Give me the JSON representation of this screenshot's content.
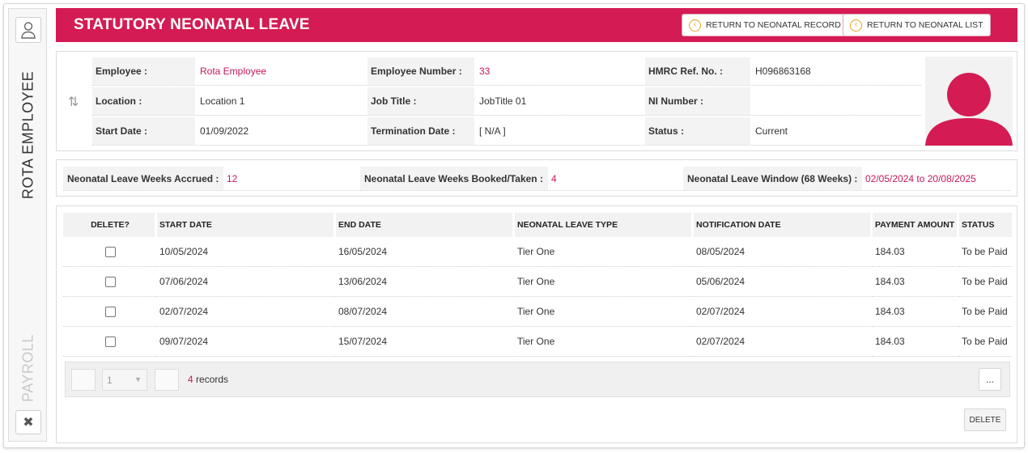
{
  "rail": {
    "title": "ROTA EMPLOYEE",
    "section": "PAYROLL",
    "user_icon": "user-icon",
    "close_icon": "close-icon"
  },
  "header": {
    "title": "STATUTORY NEONATAL LEAVE",
    "return_record": "RETURN TO NEONATAL RECORD",
    "return_list": "RETURN TO NEONATAL LIST",
    "accent": "#d41b53"
  },
  "employee": {
    "employee_label": "Employee :",
    "employee_value": "Rota Employee",
    "number_label": "Employee Number :",
    "number_value": "33",
    "hmrc_label": "HMRC Ref. No. :",
    "hmrc_value": "H096863168",
    "location_label": "Location :",
    "location_value": "Location 1",
    "job_label": "Job Title :",
    "job_value": "JobTitle 01",
    "ni_label": "NI Number :",
    "ni_value": "",
    "start_label": "Start Date :",
    "start_value": "01/09/2022",
    "term_label": "Termination Date :",
    "term_value": "[ N/A ]",
    "status_label": "Status :",
    "status_value": "Current"
  },
  "weeks": {
    "accrued_label": "Neonatal Leave Weeks Accrued :",
    "accrued_value": "12",
    "booked_label": "Neonatal Leave Weeks Booked/Taken :",
    "booked_value": "4",
    "window_label": "Neonatal Leave Window (68 Weeks) :",
    "window_value": "02/05/2024 to 20/08/2025"
  },
  "table": {
    "columns": [
      "DELETE?",
      "START DATE",
      "END DATE",
      "NEONATAL LEAVE TYPE",
      "NOTIFICATION DATE",
      "PAYMENT AMOUNT",
      "STATUS"
    ],
    "rows": [
      {
        "start": "10/05/2024",
        "end": "16/05/2024",
        "type": "Tier One",
        "notified": "08/05/2024",
        "amount": "184.03",
        "status": "To be Paid"
      },
      {
        "start": "07/06/2024",
        "end": "13/06/2024",
        "type": "Tier One",
        "notified": "05/06/2024",
        "amount": "184.03",
        "status": "To be Paid"
      },
      {
        "start": "02/07/2024",
        "end": "08/07/2024",
        "type": "Tier One",
        "notified": "02/07/2024",
        "amount": "184.03",
        "status": "To be Paid"
      },
      {
        "start": "09/07/2024",
        "end": "15/07/2024",
        "type": "Tier One",
        "notified": "02/07/2024",
        "amount": "184.03",
        "status": "To be Paid"
      }
    ]
  },
  "pager": {
    "page": "1",
    "count": "4",
    "records_label": " records",
    "more": "..."
  },
  "actions": {
    "delete": "DELETE"
  }
}
